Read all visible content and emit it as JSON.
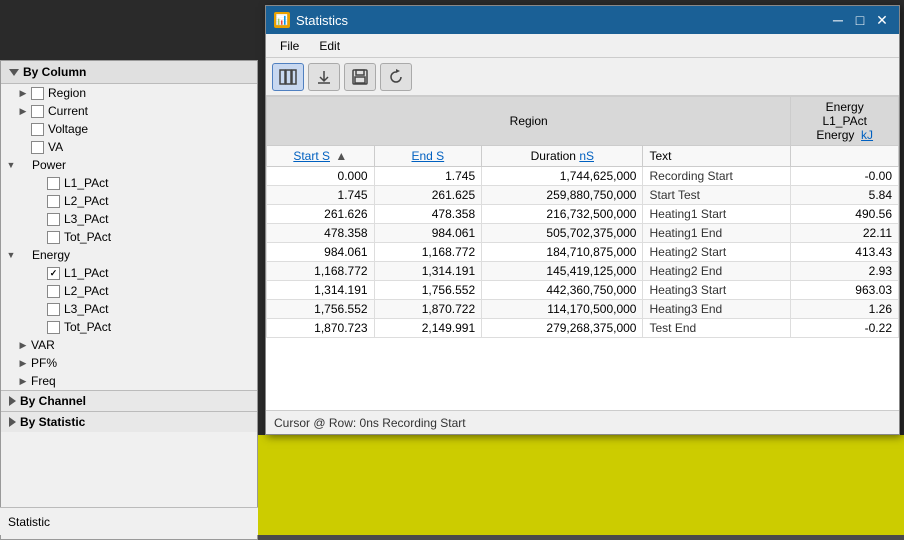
{
  "window": {
    "title": "Statistics",
    "icon": "📊"
  },
  "menu": {
    "items": [
      "File",
      "Edit"
    ]
  },
  "toolbar": {
    "buttons": [
      {
        "id": "columns",
        "icon": "⊞",
        "label": "Columns",
        "active": true
      },
      {
        "id": "export",
        "icon": "⬇",
        "label": "Export"
      },
      {
        "id": "save",
        "icon": "💾",
        "label": "Save"
      },
      {
        "id": "refresh",
        "icon": "↺",
        "label": "Refresh"
      }
    ]
  },
  "table": {
    "group_header": "Region",
    "energy_header": "Energy",
    "energy_sub": "L1_PAct",
    "energy_unit": "Energy  kJ",
    "columns": [
      {
        "key": "start",
        "label": "Start S",
        "sortable": true,
        "sorted": true
      },
      {
        "key": "end",
        "label": "End S",
        "sortable": true
      },
      {
        "key": "duration",
        "label": "Duration nS",
        "sortable": false
      },
      {
        "key": "text",
        "label": "Text",
        "sortable": false
      },
      {
        "key": "energy",
        "label": "kJ",
        "sortable": false
      }
    ],
    "rows": [
      {
        "start": "0.000",
        "end": "1.745",
        "duration": "1,744,625,000",
        "text": "Recording Start",
        "energy": "-0.00"
      },
      {
        "start": "1.745",
        "end": "261.625",
        "duration": "259,880,750,000",
        "text": "Start Test",
        "energy": "5.84"
      },
      {
        "start": "261.626",
        "end": "478.358",
        "duration": "216,732,500,000",
        "text": "Heating1 Start",
        "energy": "490.56"
      },
      {
        "start": "478.358",
        "end": "984.061",
        "duration": "505,702,375,000",
        "text": "Heating1 End",
        "energy": "22.11"
      },
      {
        "start": "984.061",
        "end": "1,168.772",
        "duration": "184,710,875,000",
        "text": "Heating2 Start",
        "energy": "413.43"
      },
      {
        "start": "1,168.772",
        "end": "1,314.191",
        "duration": "145,419,125,000",
        "text": "Heating2 End",
        "energy": "2.93"
      },
      {
        "start": "1,314.191",
        "end": "1,756.552",
        "duration": "442,360,750,000",
        "text": "Heating3 Start",
        "energy": "963.03"
      },
      {
        "start": "1,756.552",
        "end": "1,870.722",
        "duration": "114,170,500,000",
        "text": "Heating3 End",
        "energy": "1.26"
      },
      {
        "start": "1,870.723",
        "end": "2,149.991",
        "duration": "279,268,375,000",
        "text": "Test End",
        "energy": "-0.22"
      }
    ]
  },
  "status": {
    "cursor": "Cursor @ Row: 0ns Recording Start"
  },
  "sidebar": {
    "header": "By Column",
    "items": [
      {
        "label": "Region",
        "indent": 1,
        "arrow": "expanded",
        "checkbox": true,
        "checked": false
      },
      {
        "label": "Current",
        "indent": 1,
        "arrow": "expanded",
        "checkbox": true,
        "checked": false
      },
      {
        "label": "Voltage",
        "indent": 1,
        "arrow": "leaf",
        "checkbox": true,
        "checked": false
      },
      {
        "label": "VA",
        "indent": 1,
        "arrow": "leaf",
        "checkbox": true,
        "checked": false
      },
      {
        "label": "Power",
        "indent": 0,
        "arrow": "expanded",
        "checkbox": false,
        "isGroup": true
      },
      {
        "label": "L1_PAct",
        "indent": 2,
        "arrow": "leaf",
        "checkbox": true,
        "checked": false
      },
      {
        "label": "L2_PAct",
        "indent": 2,
        "arrow": "leaf",
        "checkbox": true,
        "checked": false
      },
      {
        "label": "L3_PAct",
        "indent": 2,
        "arrow": "leaf",
        "checkbox": true,
        "checked": false
      },
      {
        "label": "Tot_PAct",
        "indent": 2,
        "arrow": "leaf",
        "checkbox": true,
        "checked": false
      },
      {
        "label": "Energy",
        "indent": 0,
        "arrow": "expanded",
        "checkbox": false,
        "isGroup": true
      },
      {
        "label": "L1_PAct",
        "indent": 2,
        "arrow": "leaf",
        "checkbox": true,
        "checked": true
      },
      {
        "label": "L2_PAct",
        "indent": 2,
        "arrow": "leaf",
        "checkbox": true,
        "checked": false
      },
      {
        "label": "L3_PAct",
        "indent": 2,
        "arrow": "leaf",
        "checkbox": true,
        "checked": false
      },
      {
        "label": "Tot_PAct",
        "indent": 2,
        "arrow": "leaf",
        "checkbox": true,
        "checked": false
      },
      {
        "label": "VAR",
        "indent": 1,
        "arrow": "expanded",
        "checkbox": false
      },
      {
        "label": "PF%",
        "indent": 1,
        "arrow": "expanded",
        "checkbox": false
      },
      {
        "label": "Freq",
        "indent": 1,
        "arrow": "expanded",
        "checkbox": false
      }
    ],
    "sections": [
      {
        "label": "By Channel"
      },
      {
        "label": "By Statistic"
      }
    ]
  },
  "bottom_status": {
    "label": "Statistic"
  }
}
